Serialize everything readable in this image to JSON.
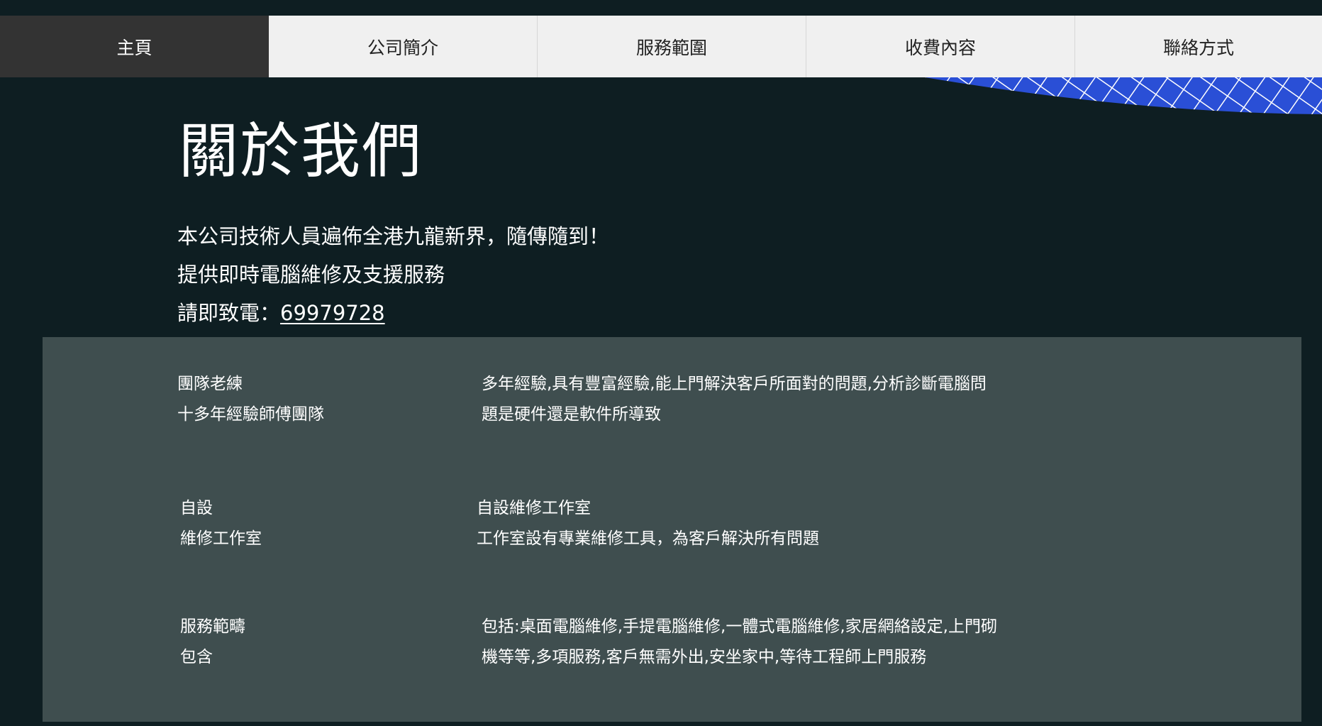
{
  "nav": {
    "items": [
      {
        "label": "主頁",
        "active": true
      },
      {
        "label": "公司簡介",
        "active": false
      },
      {
        "label": "服務範圍",
        "active": false
      },
      {
        "label": "收費內容",
        "active": false
      },
      {
        "label": "聯絡方式",
        "active": false
      }
    ]
  },
  "about": {
    "title": "關於我們",
    "intro_line1": "本公司技術人員遍佈全港九龍新界，隨傳隨到！",
    "intro_line2": "提供即時電腦維修及支援服務",
    "phone_label": "請即致電：",
    "phone_number": "69979728"
  },
  "features": [
    {
      "label_lines": [
        "團隊老練",
        "十多年經驗師傅團隊"
      ],
      "desc_lines": [
        "多年經驗,具有豐富經驗,能上門解決客戶所面對的問題,分析診斷電腦問",
        "題是硬件還是軟件所導致"
      ]
    },
    {
      "label_lines": [
        "自設",
        "維修工作室"
      ],
      "desc_lines": [
        "自設維修工作室",
        "工作室設有專業維修工具，為客戶解決所有問題"
      ]
    },
    {
      "label_lines": [
        "服務範疇",
        "包含"
      ],
      "desc_lines": [
        "包括:桌面電腦維修,手提電腦維修,一體式電腦維修,家居網絡設定,上門砌",
        "機等等,多項服務,客戶無需外出,安坐家中,等待工程師上門服務"
      ]
    }
  ],
  "colors": {
    "page_bg": "#0e1e22",
    "nav_bg": "#f0f0f0",
    "nav_active_bg": "#333333",
    "features_bg": "#3f4e4f",
    "swoosh_blue": "#2a4fd6"
  },
  "icons": {
    "decoration": "grid-pattern-swoosh"
  }
}
